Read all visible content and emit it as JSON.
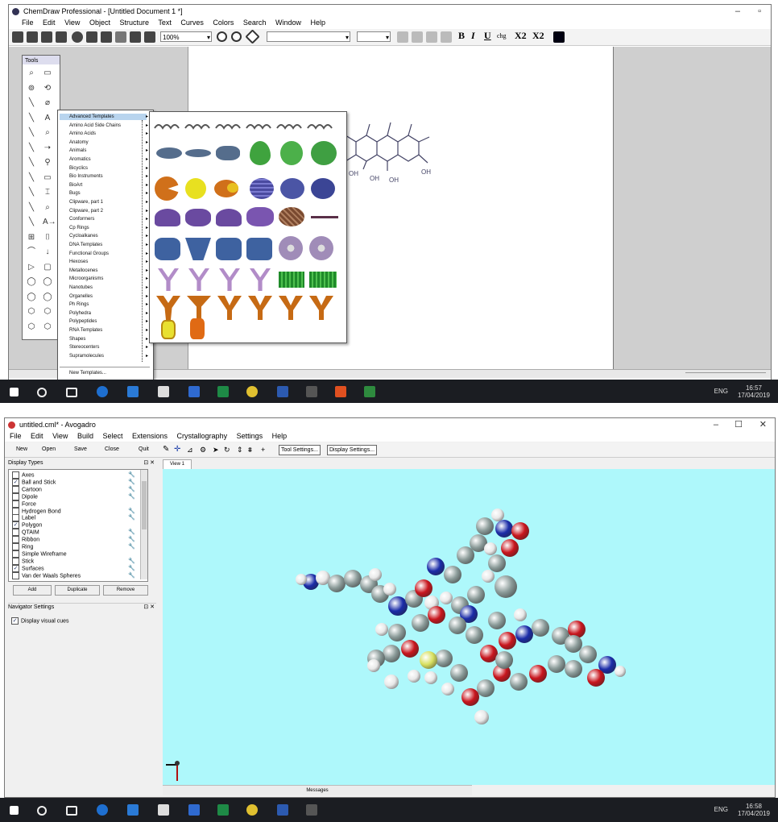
{
  "chemdraw": {
    "window_title": "ChemDraw Professional - [Untitled Document 1 *]",
    "menu": [
      "File",
      "Edit",
      "View",
      "Object",
      "Structure",
      "Text",
      "Curves",
      "Colors",
      "Search",
      "Window",
      "Help"
    ],
    "zoom": "100%",
    "toolbar_text": {
      "bold": "B",
      "italic": "I",
      "underline": "U",
      "chg": "chg",
      "xsub": "X2",
      "xsup": "X2"
    },
    "tools_label": "Tools",
    "template_menu": {
      "selected": "Advanced Templates",
      "items": [
        "Advanced Templates",
        "Amino Acid Side Chains",
        "Amino Acids",
        "Anatomy",
        "Animals",
        "Aromatics",
        "Bicyclics",
        "Bio Instruments",
        "BioArt",
        "Bugs",
        "Clipware, part 1",
        "Clipware, part 2",
        "Conformers",
        "Cp Rings",
        "Cycloalkanes",
        "DNA Templates",
        "Functional Groups",
        "Hexoses",
        "Metallocenes",
        "Microorganisms",
        "Nanotubes",
        "Organelles",
        "Ph Rings",
        "Polyhedra",
        "Polypeptides",
        "RNA Templates",
        "Shapes",
        "Stereocenters",
        "Supramolecules"
      ],
      "footer": "New Templates..."
    },
    "molecule_labels": [
      "OH",
      "OH",
      "OH",
      "OH"
    ],
    "taskbar_time": "16:57",
    "taskbar_date": "17/04/2019",
    "taskbar_lang": "ENG"
  },
  "avogadro": {
    "window_title": "untitled.cml* - Avogadro",
    "menu": [
      "File",
      "Edit",
      "View",
      "Build",
      "Select",
      "Extensions",
      "Crystallography",
      "Settings",
      "Help"
    ],
    "toolbar": {
      "new": "New",
      "open": "Open",
      "save": "Save",
      "close": "Close",
      "quit": "Quit",
      "tool_settings": "Tool Settings...",
      "display_settings": "Display Settings..."
    },
    "display_types": {
      "title": "Display Types",
      "items": [
        {
          "label": "Axes",
          "checked": false,
          "wrench": true
        },
        {
          "label": "Ball and Stick",
          "checked": true,
          "wrench": true
        },
        {
          "label": "Cartoon",
          "checked": false,
          "wrench": true
        },
        {
          "label": "Dipole",
          "checked": false,
          "wrench": true
        },
        {
          "label": "Force",
          "checked": false,
          "wrench": false
        },
        {
          "label": "Hydrogen Bond",
          "checked": false,
          "wrench": true
        },
        {
          "label": "Label",
          "checked": false,
          "wrench": true
        },
        {
          "label": "Polygon",
          "checked": true,
          "wrench": false
        },
        {
          "label": "QTAIM",
          "checked": false,
          "wrench": true
        },
        {
          "label": "Ribbon",
          "checked": false,
          "wrench": true
        },
        {
          "label": "Ring",
          "checked": false,
          "wrench": true
        },
        {
          "label": "Simple Wireframe",
          "checked": false,
          "wrench": false
        },
        {
          "label": "Stick",
          "checked": false,
          "wrench": true
        },
        {
          "label": "Surfaces",
          "checked": true,
          "wrench": true
        },
        {
          "label": "Van der Waals Spheres",
          "checked": false,
          "wrench": true
        }
      ],
      "buttons": [
        "Add",
        "Duplicate",
        "Remove"
      ]
    },
    "navigator": {
      "title": "Navigator Settings",
      "option": "Display visual cues",
      "checked": true
    },
    "view_tab": "View 1",
    "messages": "Messages",
    "taskbar_time": "16:58",
    "taskbar_date": "17/04/2019",
    "taskbar_lang": "ENG"
  },
  "colors": {
    "viewport": "#aef8fb",
    "taskbar": "#1b1d22",
    "carbon": "#8a9a98",
    "oxygen": "#c8161e",
    "nitrogen": "#1b2ca8",
    "hydrogen": "#e8e8e8",
    "sulfur": "#d8e060",
    "menu_selected": "#b8d4ee"
  }
}
